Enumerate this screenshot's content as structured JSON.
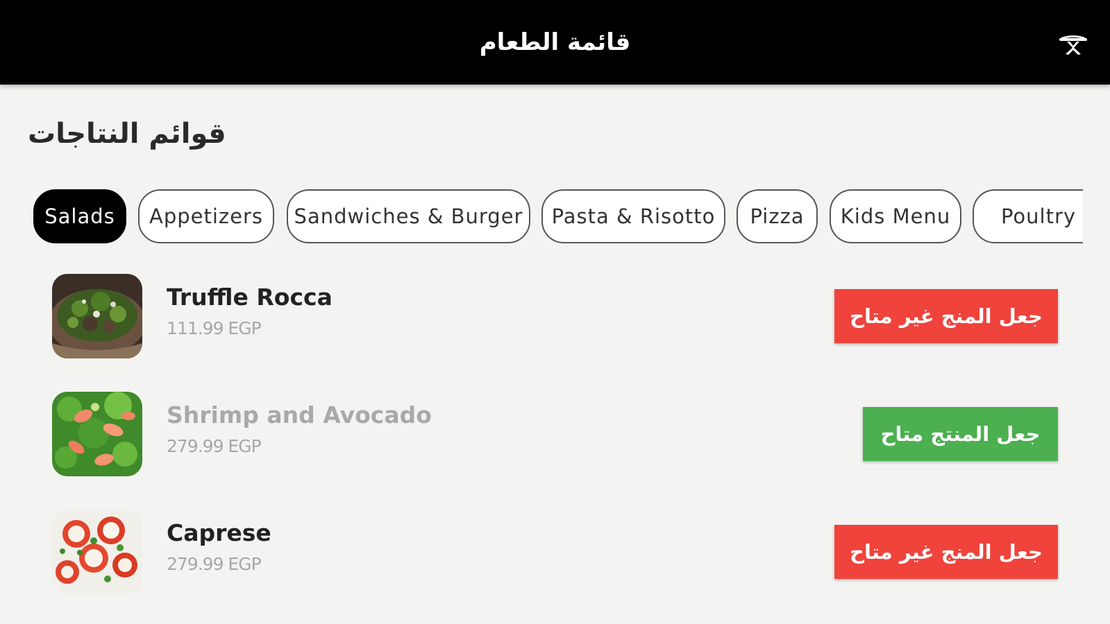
{
  "header": {
    "title": "قائمة الطعام",
    "icon": "waiter-bell-icon",
    "background": "#000000"
  },
  "section_title": "قوائم النتاجات",
  "categories": [
    {
      "label": "Salads",
      "active": true
    },
    {
      "label": "Appetizers",
      "active": false
    },
    {
      "label": "Sandwiches & Burger",
      "active": false
    },
    {
      "label": "Pasta & Risotto",
      "active": false
    },
    {
      "label": "Pizza",
      "active": false
    },
    {
      "label": "Kids Menu",
      "active": false
    },
    {
      "label": "Poultry",
      "active": false
    }
  ],
  "items": [
    {
      "name": "Truffle Rocca",
      "price": "111.99 EGP",
      "available": true,
      "action_label": "جعل المنج غير متاح",
      "action_color": "#ef433c",
      "image": "truffle-rocca-salad-image"
    },
    {
      "name": "Shrimp and Avocado",
      "price": "279.99 EGP",
      "available": false,
      "action_label": "جعل المنتج متاح",
      "action_color": "#4caf50",
      "image": "shrimp-avocado-salad-image"
    },
    {
      "name": "Caprese",
      "price": "279.99 EGP",
      "available": true,
      "action_label": "جعل المنج غير متاح",
      "action_color": "#ef433c",
      "image": "caprese-salad-image"
    }
  ]
}
